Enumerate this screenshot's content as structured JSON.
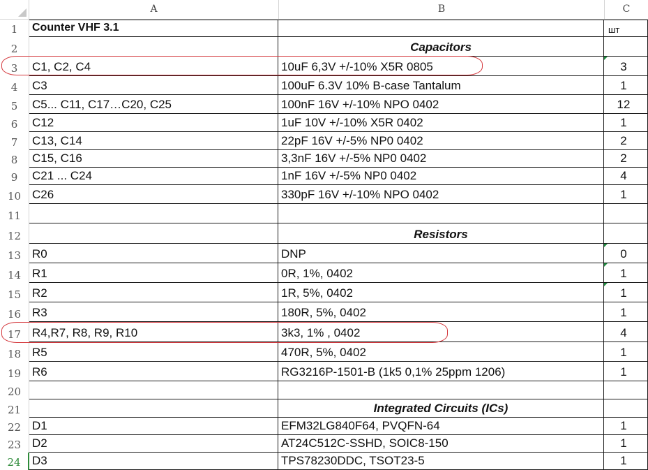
{
  "columns": [
    "A",
    "B",
    "C"
  ],
  "rows": [
    {
      "n": "1",
      "a": "Counter VHF 3.1",
      "b": "",
      "c": "шт",
      "kind": "title"
    },
    {
      "n": "2",
      "a": "",
      "b": "Capacitors",
      "c": "",
      "kind": "section"
    },
    {
      "n": "3",
      "a": "C1, C2, C4",
      "b": "10uF 6,3V +/-10% X5R  0805",
      "c": "3",
      "kind": "item"
    },
    {
      "n": "4",
      "a": "C3",
      "b": "100uF 6.3V 10% B-case Tantalum",
      "c": "1",
      "kind": "item"
    },
    {
      "n": "5",
      "a": "C5... C11, C17…C20, C25",
      "b": "100nF 16V +/-10% NPO  0402",
      "c": "12",
      "kind": "item"
    },
    {
      "n": "6",
      "a": "C12",
      "b": "1uF 10V +/-10% X5R  0402",
      "c": "1",
      "kind": "item"
    },
    {
      "n": "7",
      "a": "C13, C14",
      "b": "22pF 16V +/-5% NP0 0402",
      "c": "2",
      "kind": "item"
    },
    {
      "n": "8",
      "a": "C15, C16",
      "b": "3,3nF 16V +/-5% NP0 0402",
      "c": "2",
      "kind": "item"
    },
    {
      "n": "9",
      "a": "C21 ... C24",
      "b": "1nF 16V +/-5% NP0  0402",
      "c": "4",
      "kind": "item"
    },
    {
      "n": "10",
      "a": "C26",
      "b": "330pF 16V +/-10% NPO  0402",
      "c": "1",
      "kind": "item"
    },
    {
      "n": "11",
      "a": "",
      "b": "",
      "c": "",
      "kind": "blank"
    },
    {
      "n": "12",
      "a": "",
      "b": "Resistors",
      "c": "",
      "kind": "section"
    },
    {
      "n": "13",
      "a": "R0",
      "b": "DNP",
      "c": "0",
      "kind": "item"
    },
    {
      "n": "14",
      "a": "R1",
      "b": "0R,  1%, 0402",
      "c": "1",
      "kind": "item"
    },
    {
      "n": "15",
      "a": "R2",
      "b": "1R,   5%, 0402",
      "c": "1",
      "kind": "item"
    },
    {
      "n": "16",
      "a": "R3",
      "b": "180R,  5%, 0402",
      "c": "1",
      "kind": "item"
    },
    {
      "n": "17",
      "a": "R4,R7,  R8, R9, R10",
      "b": "3k3,   1% , 0402",
      "c": "4",
      "kind": "item"
    },
    {
      "n": "18",
      "a": "R5",
      "b": "470R,  5%, 0402",
      "c": "1",
      "kind": "item"
    },
    {
      "n": "19",
      "a": "R6",
      "b": "RG3216P-1501-B (1k5 0,1% 25ppm  1206)",
      "c": "1",
      "kind": "item"
    },
    {
      "n": "20",
      "a": "",
      "b": "",
      "c": "",
      "kind": "blank"
    },
    {
      "n": "21",
      "a": "",
      "b": "Integrated Circuits (ICs)",
      "c": "",
      "kind": "section"
    },
    {
      "n": "22",
      "a": "D1",
      "b": "EFM32LG840F64,   PVQFN-64",
      "c": "1",
      "kind": "item"
    },
    {
      "n": "23",
      "a": "D2",
      "b": "AT24C512C-SSHD, SOIC8-150",
      "c": "1",
      "kind": "item"
    },
    {
      "n": "24",
      "a": "D3",
      "b": "TPS78230DDC, TSOT23-5",
      "c": "1",
      "kind": "item"
    }
  ],
  "active_row": "24",
  "colors": {
    "highlight_ring": "#d4383d",
    "active_row": "#2e8b3a",
    "error_flag": "#1e8a3e"
  }
}
